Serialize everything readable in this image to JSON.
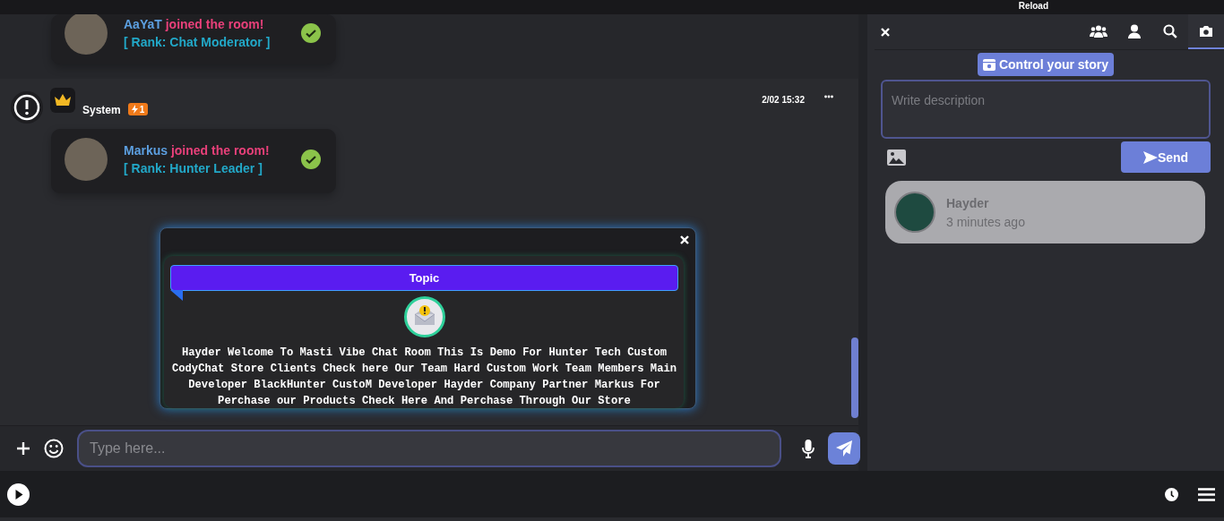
{
  "top_bar": {
    "reload": "Reload"
  },
  "chat": {
    "join_card": {
      "name": "AaYaT",
      "action": "joined the room!",
      "rank": "[ Rank: Chat Moderator ]",
      "verified": true
    },
    "system_message": {
      "sender": "System",
      "badge": "1",
      "time": "2/02 15:32",
      "join_card": {
        "name": "Markus",
        "action": "joined the room!",
        "rank": "[ Rank: Hunter Leader ]",
        "verified": true
      }
    }
  },
  "topic_popup": {
    "title": "Topic",
    "text": "Hayder Welcome To Masti Vibe Chat Room This Is Demo For Hunter Tech Custom CodyChat Store Clients Check here Our Team Hard Custom Work Team Members Main Developer BlackHunter CustoM Developer Hayder Company Partner Markus For Perchase our Products Check Here And Perchase Through Our Store"
  },
  "composer": {
    "placeholder": "Type here..."
  },
  "side_panel": {
    "tabs": [
      {
        "kind": "users",
        "selected": false
      },
      {
        "kind": "user",
        "selected": false
      },
      {
        "kind": "search",
        "selected": false
      },
      {
        "kind": "camera",
        "selected": true
      }
    ],
    "story_button": "Control your story",
    "description_placeholder": "Write description",
    "send": "Send",
    "stories": [
      {
        "name": "Hayder",
        "time": "3 minutes ago"
      }
    ]
  }
}
